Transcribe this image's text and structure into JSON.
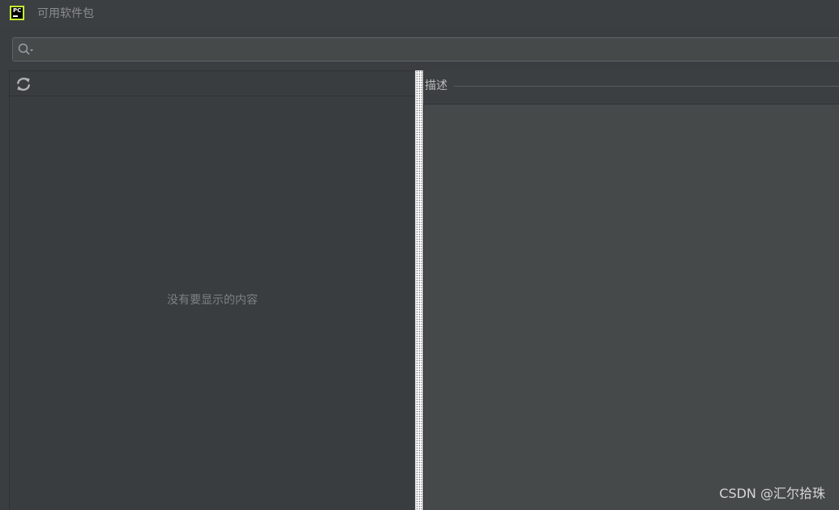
{
  "window": {
    "title": "可用软件包",
    "app_icon_text": "PC"
  },
  "search": {
    "placeholder": "",
    "value": ""
  },
  "packages_panel": {
    "empty_message": "没有要显示的内容"
  },
  "description_panel": {
    "label": "描述"
  },
  "watermark": {
    "text": "CSDN @汇尔拾珠"
  },
  "colors": {
    "background": "#3c3f41",
    "panel": "#45494a",
    "accent_icon": "#c3f22f"
  },
  "icons": {
    "search": "search-icon",
    "refresh": "refresh-icon",
    "app": "pycharm-icon"
  }
}
